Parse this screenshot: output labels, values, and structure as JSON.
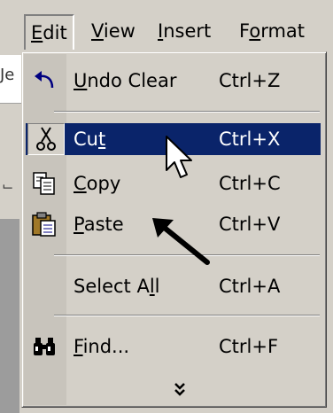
{
  "menubar": {
    "items": [
      {
        "name": "edit",
        "pre": "",
        "u": "E",
        "post": "dit"
      },
      {
        "name": "view",
        "pre": "",
        "u": "V",
        "post": "iew"
      },
      {
        "name": "insert",
        "pre": "",
        "u": "I",
        "post": "nsert"
      },
      {
        "name": "format",
        "pre": "F",
        "u": "o",
        "post": "rmat"
      }
    ]
  },
  "left": {
    "doc_fragment": "Je",
    "toolbar_fragment": "⌙"
  },
  "menu": {
    "undo": {
      "pre": "",
      "u": "U",
      "post": "ndo Clear",
      "shortcut": "Ctrl+Z",
      "icon": "undo-icon"
    },
    "cut": {
      "pre": "Cu",
      "u": "t",
      "post": "",
      "shortcut": "Ctrl+X",
      "icon": "scissors-icon"
    },
    "copy": {
      "pre": "",
      "u": "C",
      "post": "opy",
      "shortcut": "Ctrl+C",
      "icon": "copy-icon"
    },
    "paste": {
      "pre": "",
      "u": "P",
      "post": "aste",
      "shortcut": "Ctrl+V",
      "icon": "paste-icon"
    },
    "selectall": {
      "pre": "Select A",
      "u": "l",
      "post": "l",
      "shortcut": "Ctrl+A"
    },
    "find": {
      "pre": "",
      "u": "F",
      "post": "ind...",
      "shortcut": "Ctrl+F",
      "icon": "binoculars-icon"
    },
    "expand_icon": "double-chevron-down-icon"
  },
  "colors": {
    "menu_bg": "#d4d0c8",
    "highlight": "#0a246a",
    "highlight_text": "#ffffff"
  }
}
